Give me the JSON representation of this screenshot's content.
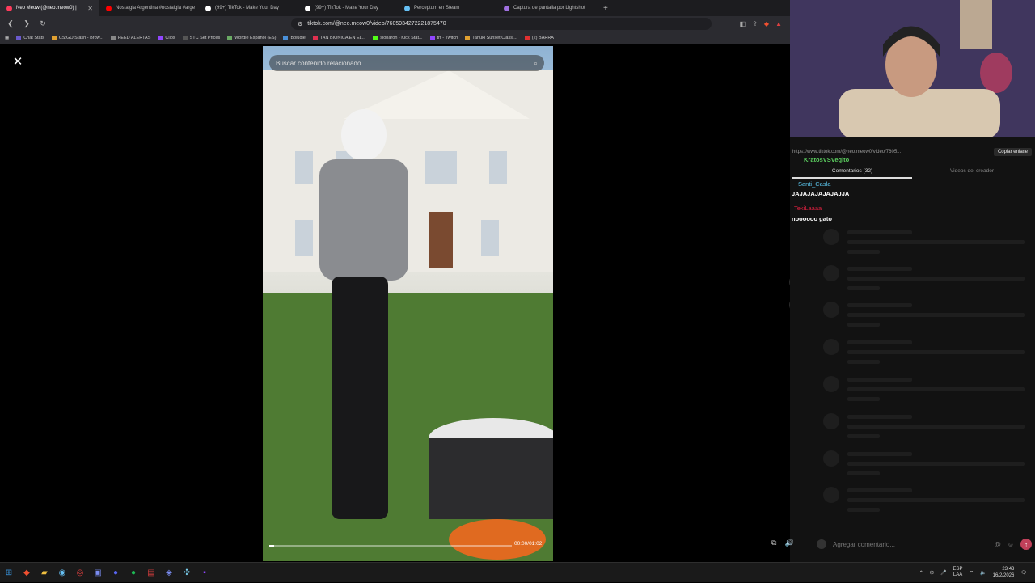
{
  "browser": {
    "tabs": [
      {
        "label": "Neo Meow (@neo.meow0) |",
        "active": true,
        "color": "#ff3b5c"
      },
      {
        "label": "Nostalgia Argentina #nostalgia #arge",
        "active": false,
        "color": "#ff0000"
      },
      {
        "label": "(99+) TikTok - Make Your Day",
        "active": false,
        "color": "#ffffff"
      },
      {
        "label": "(99+) TikTok - Make Your Day",
        "active": false,
        "color": "#ffffff"
      },
      {
        "label": "Perceptum en Steam",
        "active": false,
        "color": "#66c0f4"
      },
      {
        "label": "Captura de pantalla por Lightshot",
        "active": false,
        "color": "#a070e0"
      }
    ],
    "new_tab": "+",
    "url": "tiktok.com/@neo.meow0/video/7605934272221875470",
    "bookmarks": [
      {
        "label": "Chat Stats",
        "color": "#6a5acd"
      },
      {
        "label": "CS:GO Stash - Brow...",
        "color": "#e0a030"
      },
      {
        "label": "FEED ALERTAS",
        "color": "#888888"
      },
      {
        "label": "Clips",
        "color": "#9146ff"
      },
      {
        "label": "STC Set Prices",
        "color": "#333333"
      },
      {
        "label": "Wordle Español (ES)",
        "color": "#6aaa64"
      },
      {
        "label": "Boludle",
        "color": "#4a90d9"
      },
      {
        "label": "TAN BIONICA EN EL...",
        "color": "#e03050"
      },
      {
        "label": "sionaron - Kick Stat...",
        "color": "#53fc18"
      },
      {
        "label": "trr - Twitch",
        "color": "#9146ff"
      },
      {
        "label": "Tanuki Sunset Classi...",
        "color": "#e0a030"
      },
      {
        "label": "(2) BARRA",
        "color": "#e03030"
      }
    ]
  },
  "video": {
    "search_placeholder": "Buscar contenido relacionado",
    "timecode": "00:00/01:02",
    "progress": 0.02
  },
  "panel": {
    "link": "https://www.tiktok.com/@neo.meow0/video/7605...",
    "copy_link": "Copiar enlace",
    "chat_overlay_user": "KratosVSVegito",
    "tab_comments": "Comentarios (32)",
    "tab_creator": "Videos del creador",
    "chat": [
      {
        "user": "Santi_Casla",
        "message": "JAJAJAJAJAJAJJA",
        "color": "#5cc8f0"
      },
      {
        "user": "TekiLaaaa",
        "message": "noooooo gato",
        "color": "#e02040"
      }
    ],
    "comment_placeholder": "Agregar comentario..."
  },
  "taskbar": {
    "lang": "ESP",
    "lang2": "LAA",
    "time": "23:43",
    "date": "16/2/2026"
  }
}
